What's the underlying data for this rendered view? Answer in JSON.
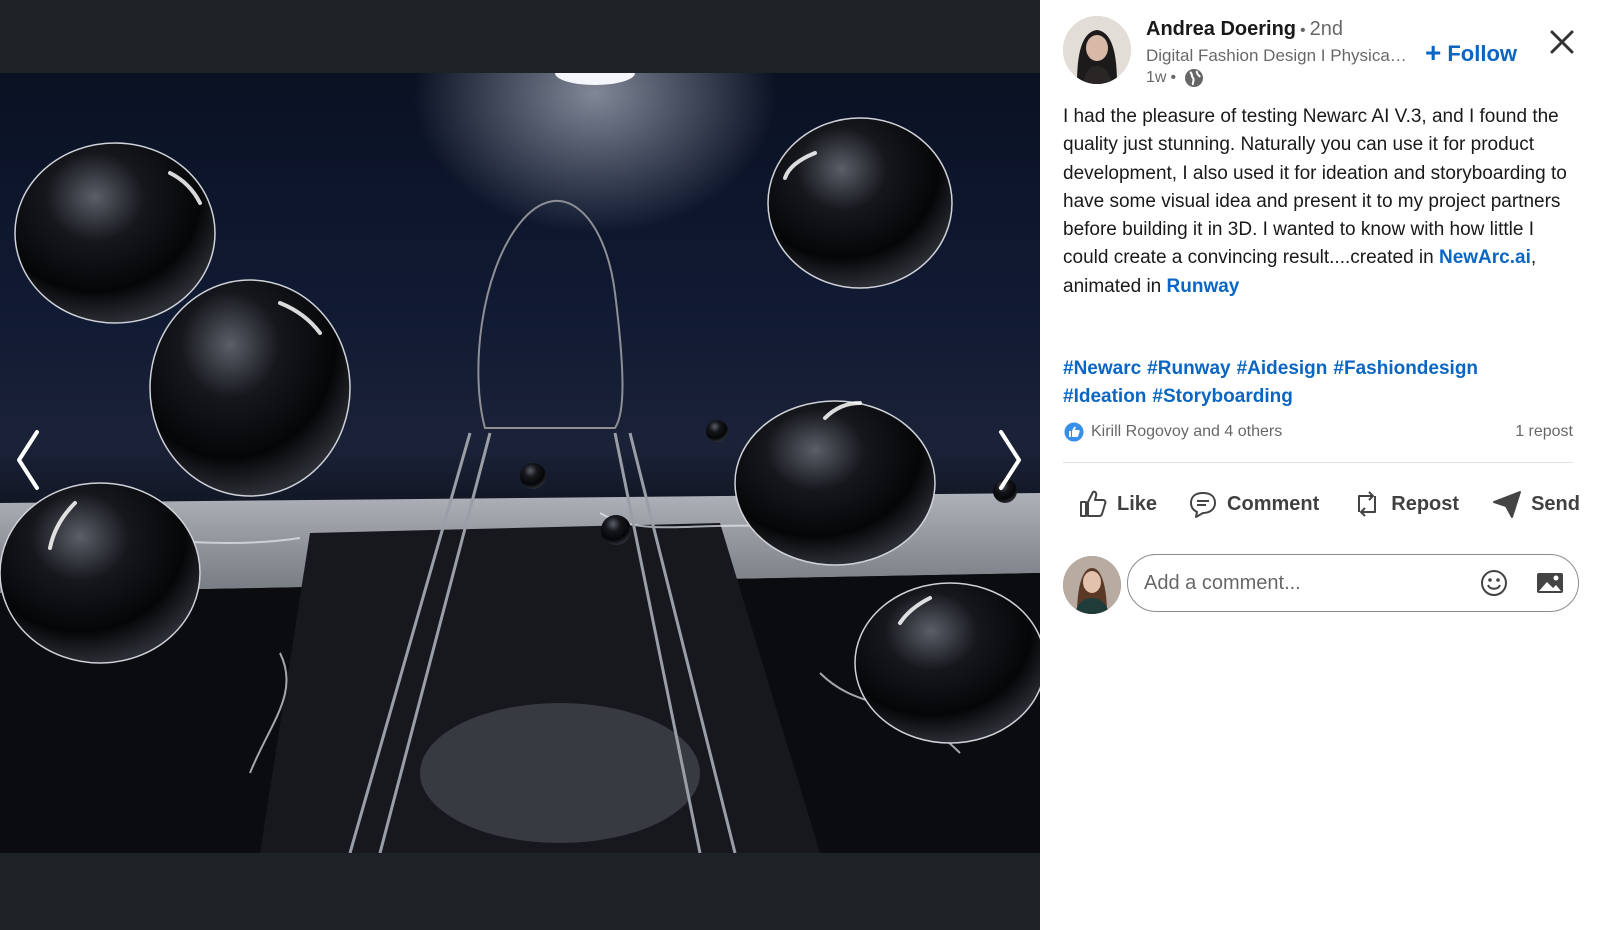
{
  "media": {
    "prev_icon": "chevron-left-icon",
    "next_icon": "chevron-right-icon"
  },
  "author": {
    "name": "Andrea Doering",
    "degree": "2nd",
    "separator": "•",
    "headline": "Digital Fashion Design I Physical Fashion Design",
    "time": "1w",
    "visibility_icon": "globe-icon"
  },
  "follow": {
    "plus": "+",
    "label": "Follow"
  },
  "close_icon": "close-icon",
  "post": {
    "text_before": "I had the pleasure of testing Newarc AI V.3, and I found the quality just stunning. Naturally you can use it for product development, I also used it for ideation and storyboarding to have some visual idea and present it to my project partners before building it in 3D. I wanted to know with how little I could create a convincing result....created in ",
    "link1": "NewArc.ai",
    "text_middle": ", animated in ",
    "link2": "Runway",
    "hashtags": [
      "#Newarc",
      "#Runway",
      "#Aidesign",
      "#Fashiondesign",
      "#Ideation",
      "#Storyboarding"
    ]
  },
  "social": {
    "reaction_icon": "like-reaction-icon",
    "reactions_text": "Kirill Rogovoy and 4 others",
    "reposts_text": "1 repost"
  },
  "actions": {
    "like": "Like",
    "comment": "Comment",
    "repost": "Repost",
    "send": "Send"
  },
  "comment": {
    "placeholder": "Add a comment...",
    "emoji_icon": "emoji-icon",
    "image_icon": "image-icon"
  },
  "colors": {
    "brand_blue": "#0a66c2",
    "media_background": "#1d2226"
  }
}
